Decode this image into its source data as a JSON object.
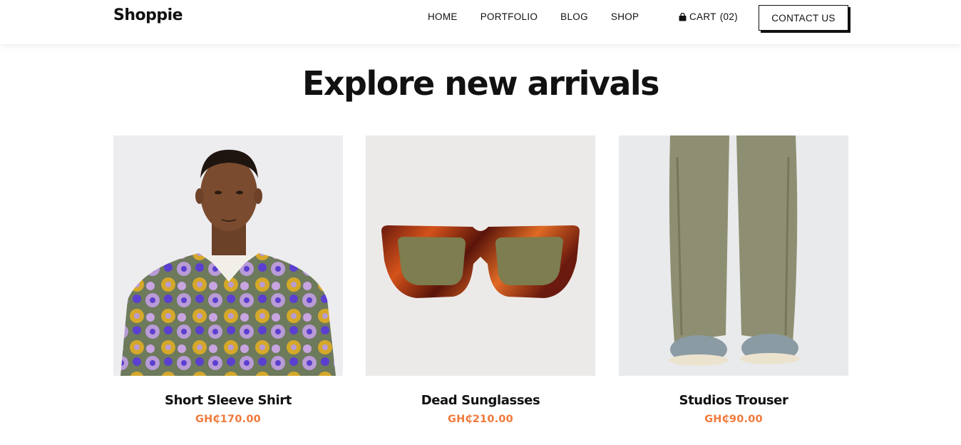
{
  "header": {
    "logo": "Shoppie",
    "nav": [
      "HOME",
      "PORTFOLIO",
      "BLOG",
      "SHOP"
    ],
    "cart_label": "CART",
    "cart_count": "(02)",
    "cart_icon": "shopping-bag-icon",
    "contact_label": "CONTACT US"
  },
  "section": {
    "title": "Explore new arrivals"
  },
  "colors": {
    "price": "#f07a3c",
    "text": "#111111"
  },
  "products": [
    {
      "name": "Short Sleeve Shirt",
      "price": "GH₵170.00"
    },
    {
      "name": "Dead Sunglasses",
      "price": "GH₵210.00"
    },
    {
      "name": "Studios Trouser",
      "price": "GH₵90.00"
    }
  ]
}
